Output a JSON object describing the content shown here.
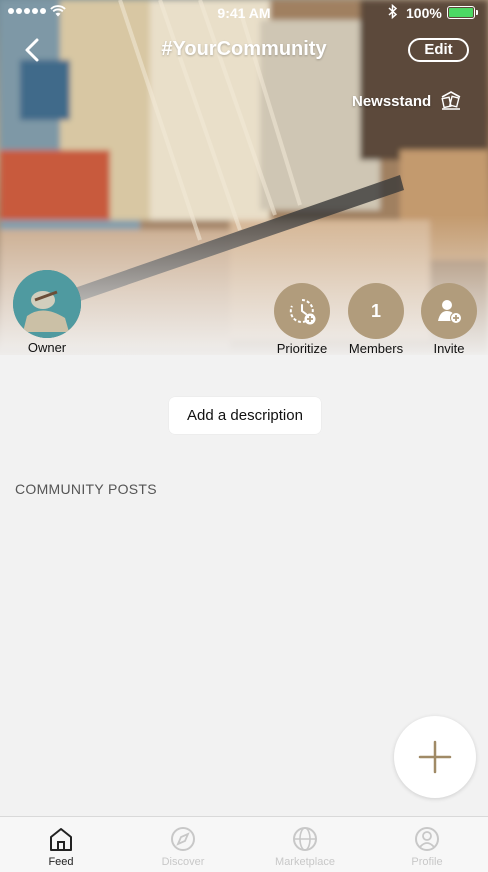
{
  "status_bar": {
    "time": "9:41 AM",
    "battery_percent": "100%",
    "battery_level": 1.0
  },
  "nav": {
    "title": "#YourCommunity",
    "edit_label": "Edit",
    "back_icon": "chevron-left-icon"
  },
  "category": {
    "label": "Newsstand",
    "icon": "newsstand-icon"
  },
  "owner": {
    "label": "Owner"
  },
  "actions": {
    "prioritize_label": "Prioritize",
    "members_label": "Members",
    "members_count": "1",
    "invite_label": "Invite"
  },
  "description": {
    "button_label": "Add a description"
  },
  "posts": {
    "header": "COMMUNITY POSTS"
  },
  "tabs": [
    {
      "label": "Feed",
      "icon": "home-icon",
      "active": true
    },
    {
      "label": "Discover",
      "icon": "compass-icon",
      "active": false
    },
    {
      "label": "Marketplace",
      "icon": "globe-icon",
      "active": false
    },
    {
      "label": "Profile",
      "icon": "profile-icon",
      "active": false
    }
  ],
  "colors": {
    "accent": "#b19c7c",
    "background": "#f2f2f2",
    "tab_inactive": "#c8c8c8",
    "tab_active": "#222222"
  }
}
